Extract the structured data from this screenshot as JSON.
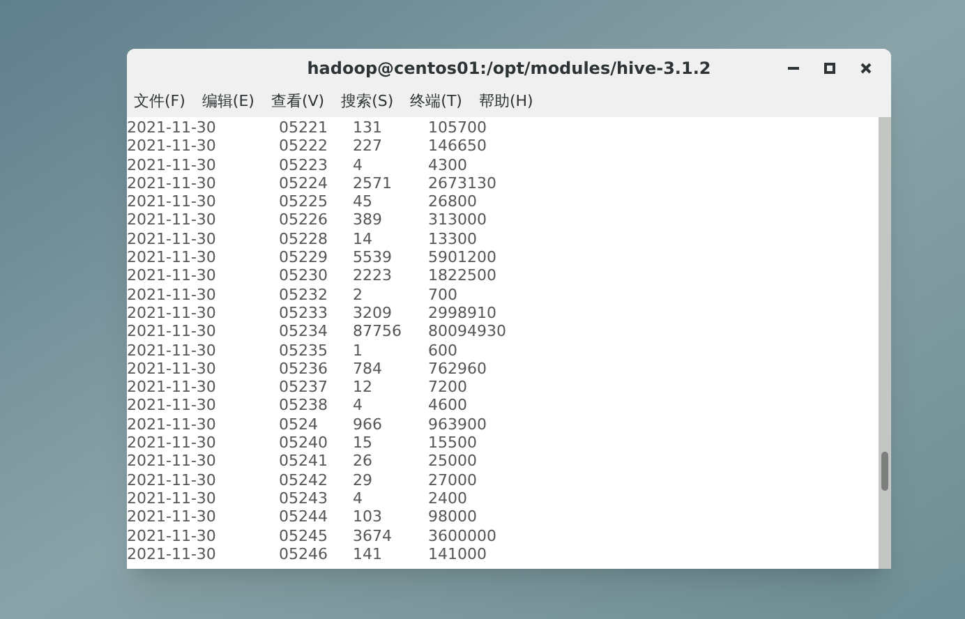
{
  "window": {
    "title": "hadoop@centos01:/opt/modules/hive-3.1.2"
  },
  "menu": [
    "文件(F)",
    "编辑(E)",
    "查看(V)",
    "搜索(S)",
    "终端(T)",
    "帮助(H)"
  ],
  "rows": [
    [
      "2021-11-30",
      "05221",
      "131",
      "105700"
    ],
    [
      "2021-11-30",
      "05222",
      "227",
      "146650"
    ],
    [
      "2021-11-30",
      "05223",
      "4",
      "4300"
    ],
    [
      "2021-11-30",
      "05224",
      "2571",
      "2673130"
    ],
    [
      "2021-11-30",
      "05225",
      "45",
      "26800"
    ],
    [
      "2021-11-30",
      "05226",
      "389",
      "313000"
    ],
    [
      "2021-11-30",
      "05228",
      "14",
      "13300"
    ],
    [
      "2021-11-30",
      "05229",
      "5539",
      "5901200"
    ],
    [
      "2021-11-30",
      "05230",
      "2223",
      "1822500"
    ],
    [
      "2021-11-30",
      "05232",
      "2",
      "700"
    ],
    [
      "2021-11-30",
      "05233",
      "3209",
      "2998910"
    ],
    [
      "2021-11-30",
      "05234",
      "87756",
      "80094930"
    ],
    [
      "2021-11-30",
      "05235",
      "1",
      "600"
    ],
    [
      "2021-11-30",
      "05236",
      "784",
      "762960"
    ],
    [
      "2021-11-30",
      "05237",
      "12",
      "7200"
    ],
    [
      "2021-11-30",
      "05238",
      "4",
      "4600"
    ],
    [
      "2021-11-30",
      "0524",
      "966",
      "963900"
    ],
    [
      "2021-11-30",
      "05240",
      "15",
      "15500"
    ],
    [
      "2021-11-30",
      "05241",
      "26",
      "25000"
    ],
    [
      "2021-11-30",
      "05242",
      "29",
      "27000"
    ],
    [
      "2021-11-30",
      "05243",
      "4",
      "2400"
    ],
    [
      "2021-11-30",
      "05244",
      "103",
      "98000"
    ],
    [
      "2021-11-30",
      "05245",
      "3674",
      "3600000"
    ],
    [
      "2021-11-30",
      "05246",
      "141",
      "141000"
    ]
  ]
}
